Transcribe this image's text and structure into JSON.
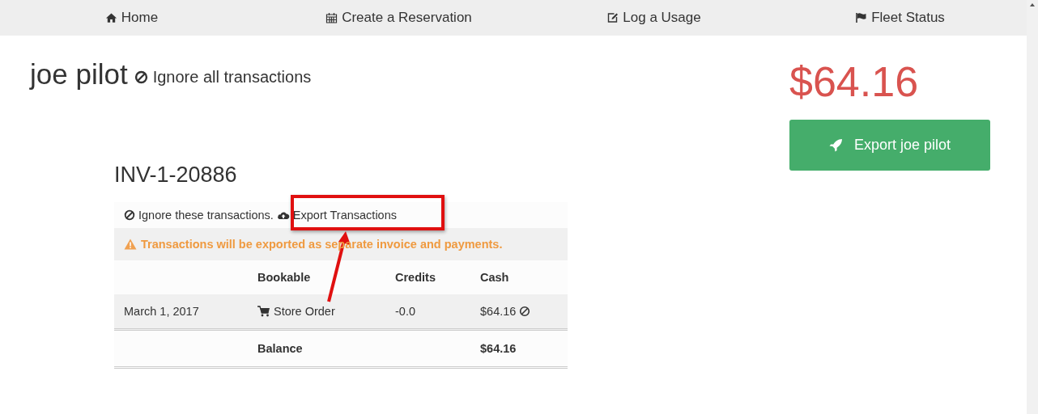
{
  "nav": [
    {
      "kind": "home",
      "label": "Home"
    },
    {
      "kind": "calendar",
      "label": "Create a Reservation"
    },
    {
      "kind": "edit",
      "label": "Log a Usage"
    },
    {
      "kind": "flag",
      "label": "Fleet Status"
    }
  ],
  "pilot": {
    "name": "joe pilot",
    "ignore_link": "Ignore all transactions",
    "balance": "$64.16",
    "export_button": "Export joe pilot"
  },
  "invoice": {
    "title": "INV-1-20886",
    "ignore_link": "Ignore these transactions.",
    "export_link": "Export Transactions",
    "warning": "Transactions will be exported as separate invoice and payments.",
    "columns": [
      "Bookable",
      "Credits",
      "Cash"
    ],
    "rows": [
      {
        "date": "March 1, 2017",
        "bookable": "Store Order",
        "credits": "-0.0",
        "cash": "$64.16"
      }
    ],
    "balance_label": "Balance",
    "balance": "$64.16"
  }
}
